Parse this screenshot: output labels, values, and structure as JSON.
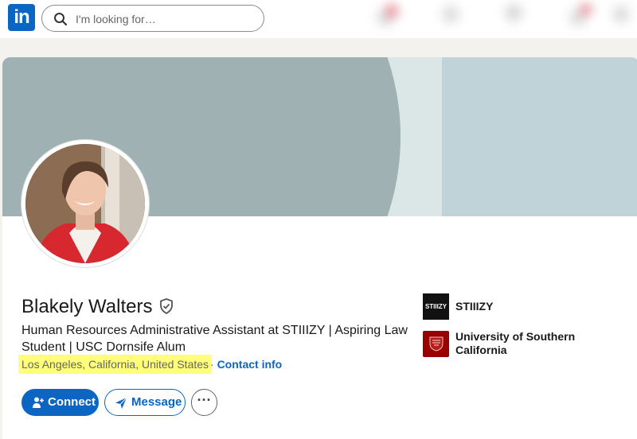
{
  "app": {
    "logo_text": "in",
    "brand_color": "#0a66c2"
  },
  "search": {
    "placeholder": "I'm looking for…"
  },
  "profile": {
    "name": "Blakely Walters",
    "headline": "Human Resources Administrative Assistant at STIIIZY | Aspiring Law Student | USC Dornsife Alum",
    "location": "Los Angeles, California, United States",
    "separator": "·",
    "contact_info": "Contact info"
  },
  "actions": {
    "connect": "Connect",
    "message": "Message",
    "more": "···"
  },
  "organizations": [
    {
      "name": "STIIIZY",
      "logo_text": "STIIIZY",
      "logo_color": "#111111"
    },
    {
      "name": "University of Southern California",
      "logo_color": "#990000"
    }
  ],
  "colors": {
    "highlight": "#ffff7a",
    "banner_light": "#bfd3d8",
    "banner_dark": "#9fb1b3"
  },
  "icons": [
    "search-icon",
    "verified-shield-icon",
    "add-person-icon",
    "send-icon",
    "more-icon"
  ]
}
